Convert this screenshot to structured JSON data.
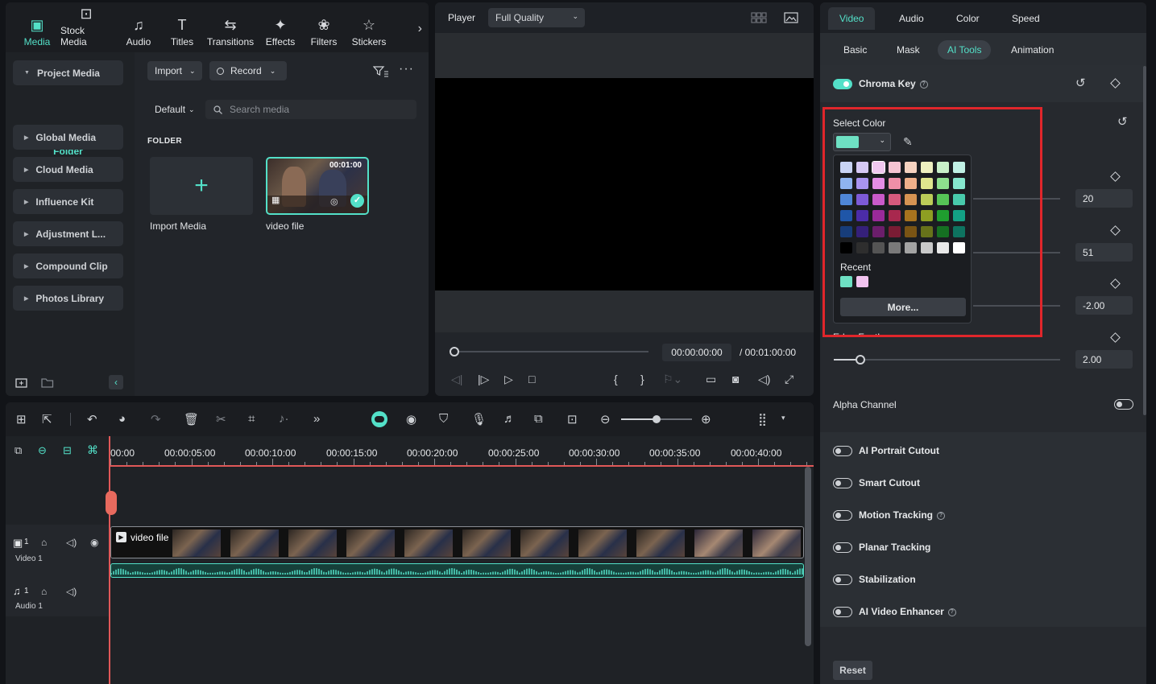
{
  "media_toolbar": {
    "tabs": [
      {
        "label": "Media",
        "icon": "media-icon",
        "glyph": "▣"
      },
      {
        "label": "Stock Media",
        "icon": "stock-media-icon",
        "glyph": "⊡"
      },
      {
        "label": "Audio",
        "icon": "music-note-icon",
        "glyph": "♫"
      },
      {
        "label": "Titles",
        "icon": "titles-icon",
        "glyph": "T"
      },
      {
        "label": "Transitions",
        "icon": "transitions-icon",
        "glyph": "⇆"
      },
      {
        "label": "Effects",
        "icon": "effects-icon",
        "glyph": "✦"
      },
      {
        "label": "Filters",
        "icon": "filters-icon",
        "glyph": "❀"
      },
      {
        "label": "Stickers",
        "icon": "stickers-icon",
        "glyph": "☆"
      }
    ]
  },
  "media_sidebar": {
    "project_media": "Project Media",
    "folder": "Folder",
    "items": [
      "Global Media",
      "Cloud Media",
      "Influence Kit",
      "Adjustment L...",
      "Compound Clip",
      "Photos Library"
    ]
  },
  "media_main": {
    "import_label": "Import",
    "record_label": "Record",
    "sort_label": "Default",
    "search_placeholder": "Search media",
    "folder_heading": "FOLDER",
    "import_tile_label": "Import Media",
    "video_tile_label": "video file",
    "video_duration": "00:01:00"
  },
  "player": {
    "label": "Player",
    "quality": "Full Quality",
    "current_time": "00:00:00:00",
    "total_time": "/  00:01:00:00"
  },
  "properties": {
    "tabs": [
      "Video",
      "Audio",
      "Color",
      "Speed"
    ],
    "sub_tabs": [
      "Basic",
      "Mask",
      "AI Tools",
      "Animation"
    ],
    "chroma_key": "Chroma Key",
    "select_color": "Select Color",
    "recent_label": "Recent",
    "more_label": "More...",
    "values": [
      "20",
      "51",
      "-2.00",
      "2.00"
    ],
    "edge_feather": "Edge Feather",
    "alpha_channel": "Alpha Channel",
    "ai_tools": [
      "AI Portrait Cutout",
      "Smart Cutout",
      "Motion Tracking",
      "Planar Tracking",
      "Stabilization",
      "AI Video Enhancer"
    ],
    "reset_label": "Reset",
    "selected_color": "#6ee0c3",
    "recent_colors": [
      "#6ee0c3",
      "#f2c4f0"
    ]
  },
  "palette": [
    [
      "#c9d4f5",
      "#d6c9f5",
      "#f0c8f0",
      "#f5c4d2",
      "#f5d2c0",
      "#eef0c0",
      "#c8f0c8",
      "#c0f0e4"
    ],
    [
      "#8fb4f0",
      "#a994f0",
      "#e48ee6",
      "#ef8fa8",
      "#f0b08a",
      "#dfe68e",
      "#8ee08e",
      "#86e6cd"
    ],
    [
      "#4f86d6",
      "#7d5ad6",
      "#c95ac9",
      "#d65a7d",
      "#d69352",
      "#bccc58",
      "#56c456",
      "#48c9aa"
    ],
    [
      "#1f56a8",
      "#4b2ca8",
      "#9a2a9a",
      "#a8284e",
      "#a8731e",
      "#8e9e22",
      "#1f9e2f",
      "#13a084"
    ],
    [
      "#173d7a",
      "#352079",
      "#6b1e6b",
      "#7a1c34",
      "#7a5414",
      "#67721a",
      "#157022",
      "#0e7360"
    ],
    [
      "#000000",
      "#2e2e2e",
      "#545454",
      "#7a7a7a",
      "#a3a3a3",
      "#c9c9c9",
      "#e8e8e8",
      "#ffffff"
    ]
  ],
  "timeline": {
    "ruler": [
      "00:00",
      "00:00:05:00",
      "00:00:10:00",
      "00:00:15:00",
      "00:00:20:00",
      "00:00:25:00",
      "00:00:30:00",
      "00:00:35:00",
      "00:00:40:00"
    ],
    "video_track": "Video 1",
    "audio_track": "Audio 1",
    "clip_label": "video file",
    "track_num": "1"
  }
}
